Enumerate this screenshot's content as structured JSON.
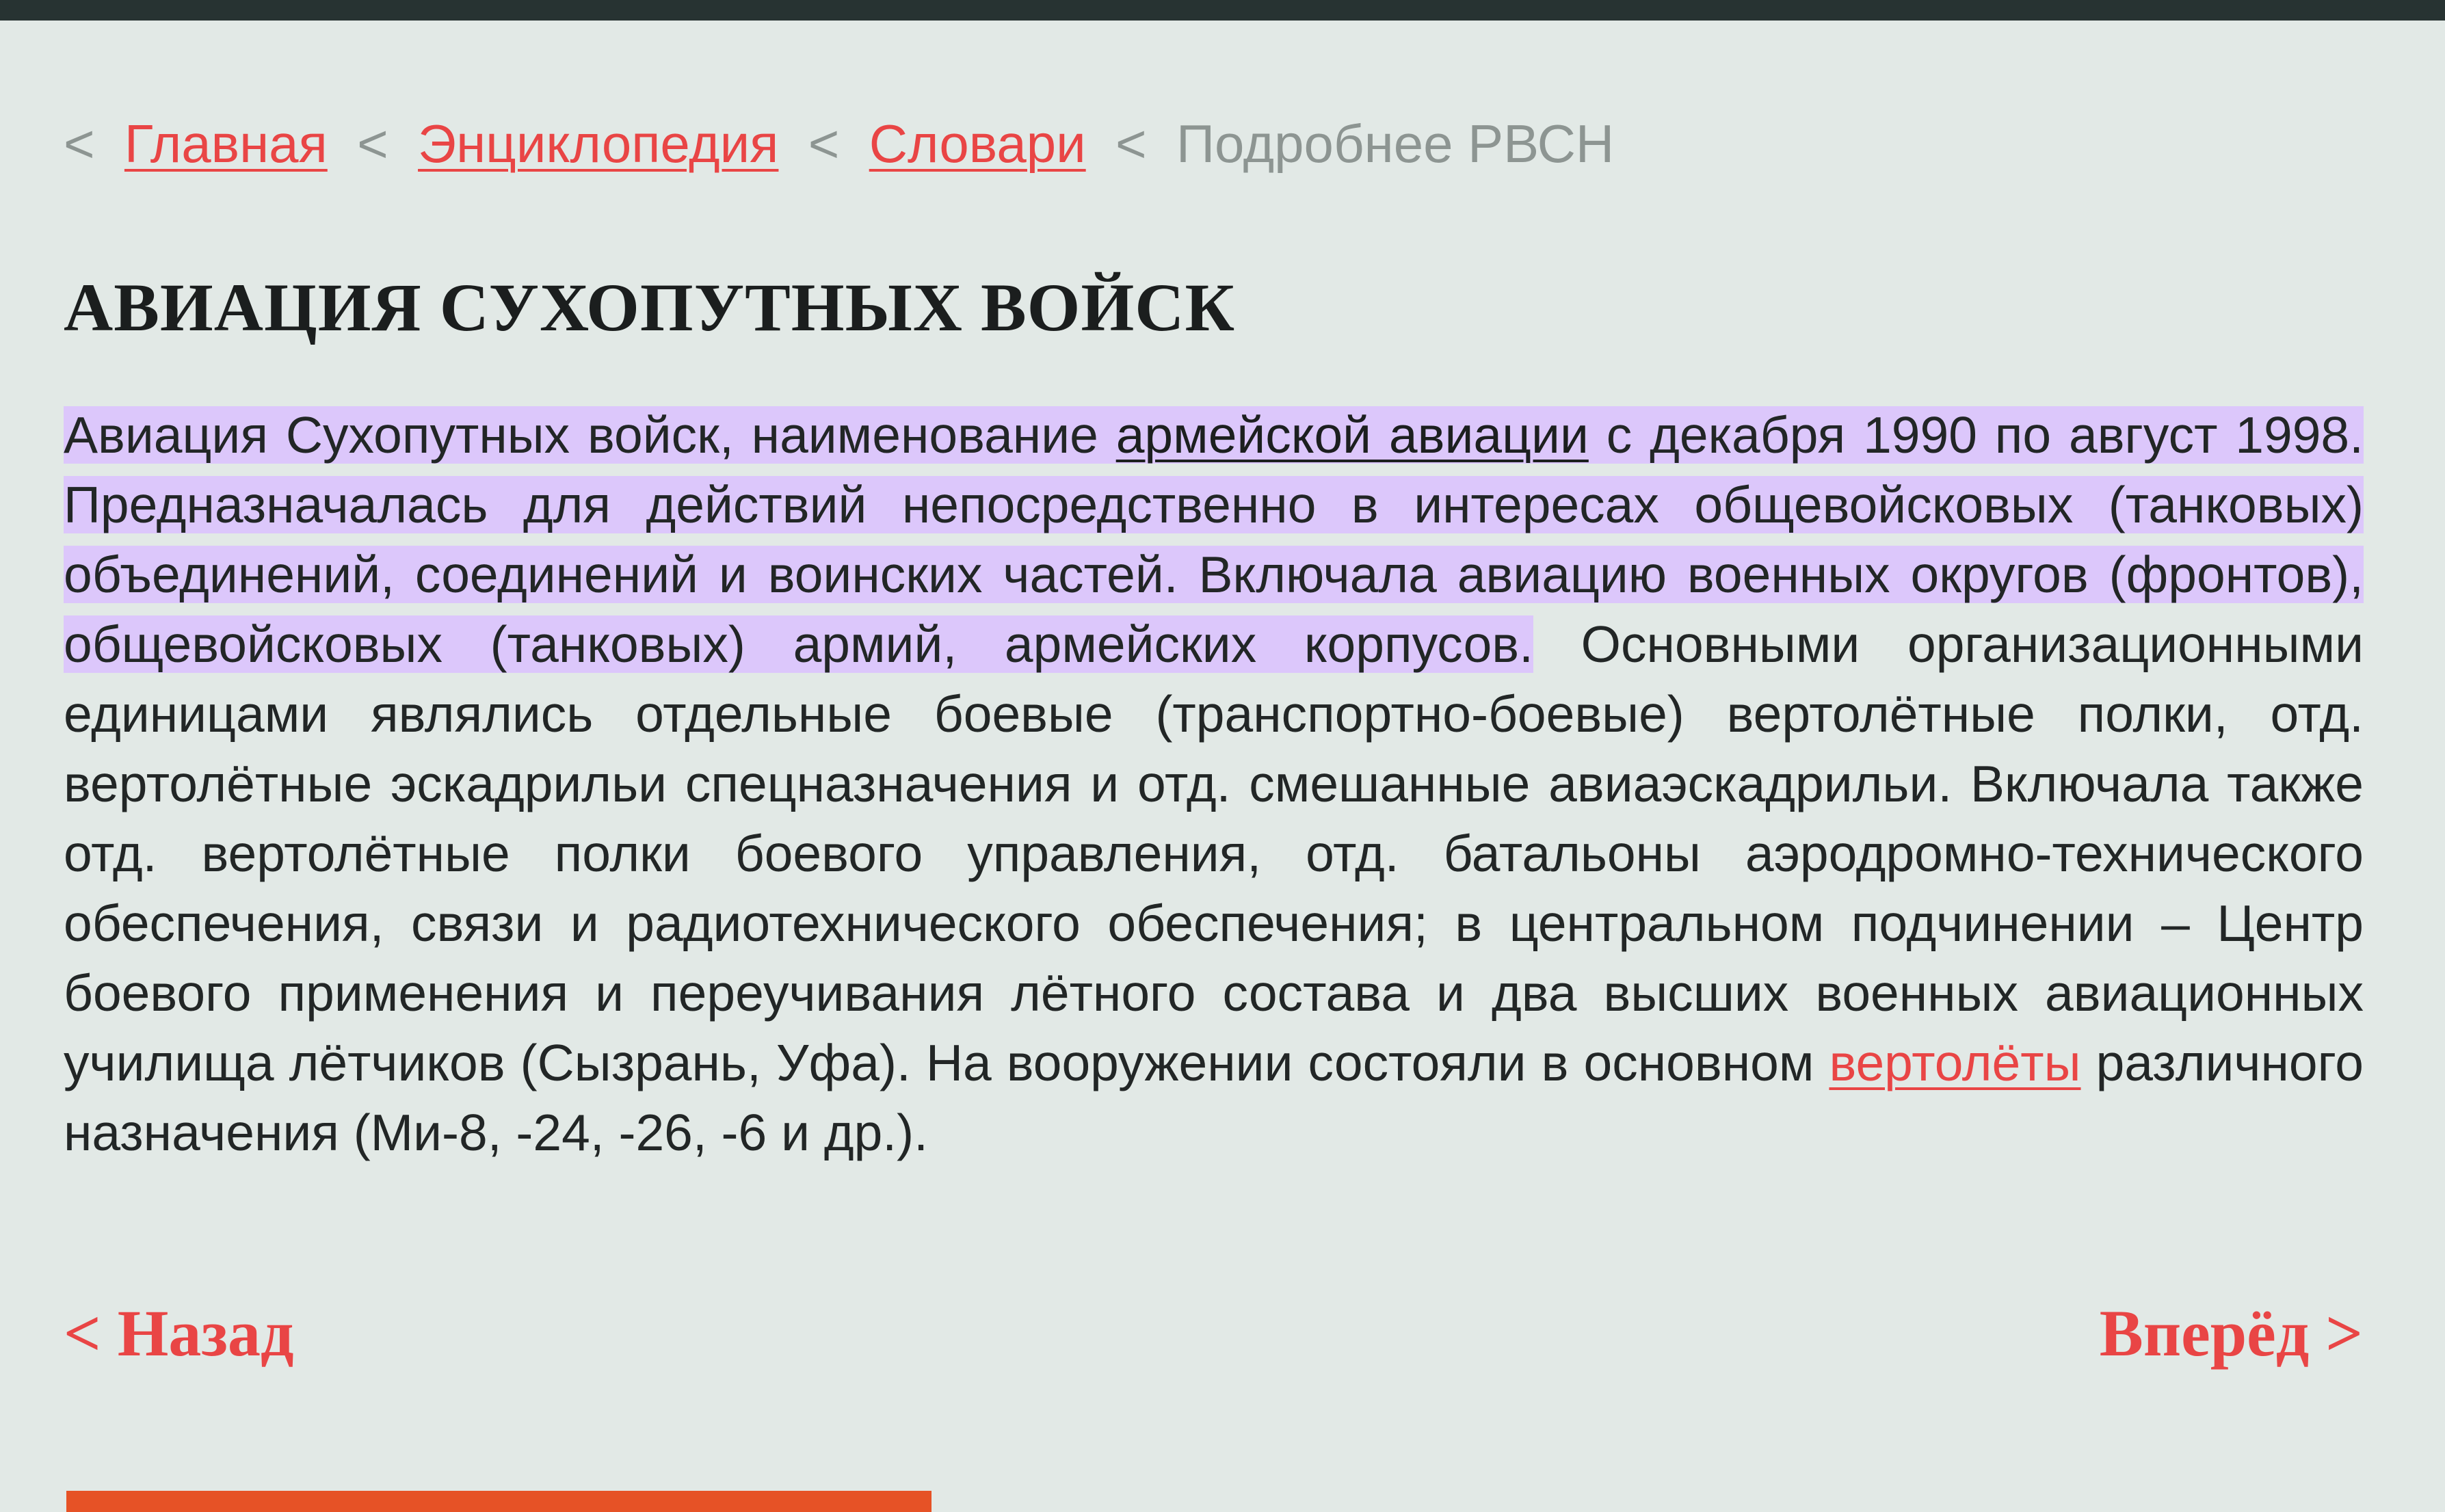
{
  "breadcrumb": {
    "sep": "<",
    "items": [
      {
        "label": "Главная",
        "link": true
      },
      {
        "label": "Энциклопедия",
        "link": true
      },
      {
        "label": "Словари",
        "link": true
      },
      {
        "label": "Подробнее РВСН",
        "link": false
      }
    ]
  },
  "article": {
    "title": "АВИАЦИЯ СУХОПУТНЫХ ВОЙСК",
    "segments": {
      "s1": "Авиация Сухопутных войск, наименование ",
      "link1": "армейской авиации",
      "s2": " с декабря 1990 по август 1998. Предназначалась для действий непосредственно в интересах общевойсковых (танковых) объединений, соединений и воинских частей. Включала авиацию военных округов (фронтов), общевойсковых (танковых) армий, армейских корпусов.",
      "s3": " Основными организационными единицами являлись отдельные боевые (транспортно-боевые) вертолётные полки, отд. вертолётные эскадрильи спецназначения и отд. смешанные авиаэскадрильи. Включала также отд. вертолётные полки боевого управления, отд. батальоны аэродромно-технического обеспечения, связи и радиотехнического обеспечения; в центральном подчинении – Центр боевого применения и переучивания лётного состава и два высших военных авиационных училища лётчиков (Сызрань, Уфа). На вооружении состояли в основном ",
      "link2": "вертолёты",
      "s4": " различного назначения (Ми-8, -24, -26, -6 и др.)."
    }
  },
  "nav": {
    "back_label": "< Назад",
    "forward_label": "Вперёд >"
  },
  "colors": {
    "background": "#e2e9e6",
    "top_bar": "#273332",
    "link": "#e94545",
    "highlight": "#dcc7fb",
    "bottom_accent": "#e65226"
  }
}
